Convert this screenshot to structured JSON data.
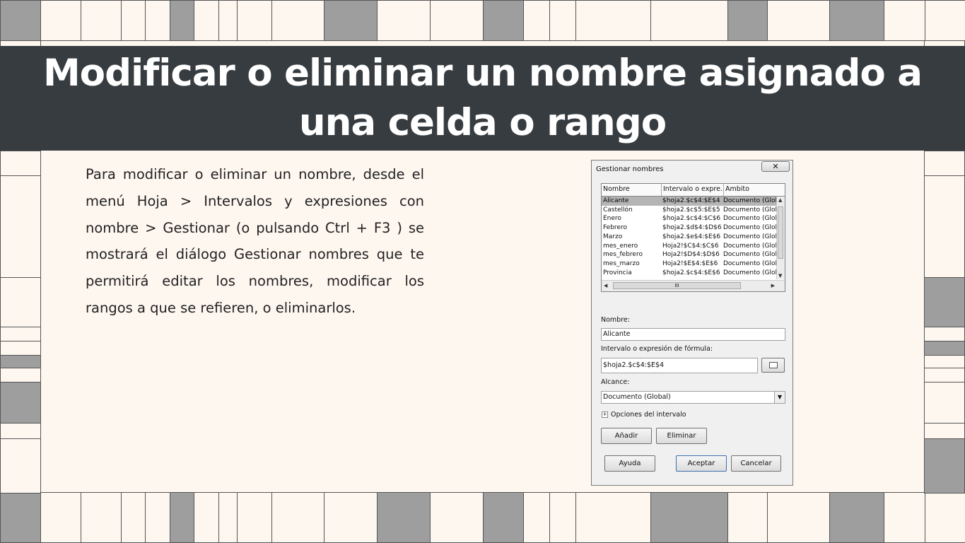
{
  "banner": {
    "title": "Modificar o eliminar un nombre asignado a una celda o rango"
  },
  "paragraph": "Para modificar o eliminar un nombre, desde el menú Hoja > Intervalos y expresiones con nombre > Gestionar (o pulsando Ctrl + F3 ) se mostrará el diálogo Gestionar nombres que te permitirá editar los nombres, modificar los rangos a que se refieren, o eliminarlos.",
  "dialog": {
    "title": "Gestionar nombres",
    "close_label": "✕",
    "columns": [
      "Nombre",
      "Intervalo o expre...",
      "Ámbito"
    ],
    "rows": [
      {
        "name": "Alicante",
        "range": "$hoja2.$c$4:$E$4",
        "scope": "Documento (Glob"
      },
      {
        "name": "Castellón",
        "range": "$hoja2.$c$5:$E$5",
        "scope": "Documento (Glob"
      },
      {
        "name": "Enero",
        "range": "$hoja2.$c$4:$C$6",
        "scope": "Documento (Glob"
      },
      {
        "name": "Febrero",
        "range": "$hoja2.$d$4:$D$6",
        "scope": "Documento (Glob"
      },
      {
        "name": "Marzo",
        "range": "$hoja2.$e$4:$E$6",
        "scope": "Documento (Glob"
      },
      {
        "name": "mes_enero",
        "range": "Hoja2!$C$4:$C$6",
        "scope": "Documento (Glob"
      },
      {
        "name": "mes_febrero",
        "range": "Hoja2!$D$4:$D$6",
        "scope": "Documento (Glob"
      },
      {
        "name": "mes_marzo",
        "range": "Hoja2!$E$4:$E$6",
        "scope": "Documento (Glob"
      },
      {
        "name": "Provincia",
        "range": "$hoja2.$c$4:$E$6",
        "scope": "Documento (Glob"
      }
    ],
    "hscroll_grip": "III",
    "name_label": "Nombre:",
    "name_value": "Alicante",
    "range_label": "Intervalo o expresión de fórmula:",
    "range_value": "$hoja2.$c$4:$E$4",
    "scope_label": "Alcance:",
    "scope_value": "Documento (Global)",
    "options_label": "Opciones del intervalo",
    "add_label": "Añadir",
    "delete_label": "Eliminar",
    "help_label": "Ayuda",
    "ok_label": "Aceptar",
    "cancel_label": "Cancelar"
  },
  "colors": {
    "banner": "#363c40",
    "background": "#fef7f0",
    "gray_tile": "#9e9e9e"
  }
}
